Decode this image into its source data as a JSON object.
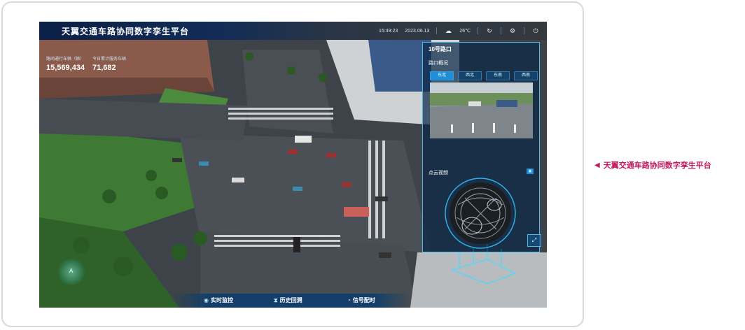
{
  "app": {
    "title": "天翼交通车路协同数字孪生平台"
  },
  "topbar": {
    "time": "15:49:23",
    "date": "2023.06.13",
    "temperature": "26℃"
  },
  "stats": [
    {
      "label": "路网通行车辆（辆）",
      "value": "15,569,434"
    },
    {
      "label": "今日累计服务车辆",
      "value": "71,682"
    }
  ],
  "panel": {
    "title": "10号路口",
    "overview_title": "路口概况",
    "tabs": [
      "东北",
      "西北",
      "东南",
      "西南"
    ],
    "active_tab": 0,
    "lidar_title": "点云视频"
  },
  "bottom_nav": [
    {
      "label": "实时监控",
      "icon": "monitor-icon"
    },
    {
      "label": "历史回溯",
      "icon": "hourglass-icon"
    },
    {
      "label": "信号配时",
      "icon": "signal-icon"
    }
  ],
  "compass": {
    "label": "A"
  },
  "caption": {
    "text": "天翼交通车路协同数字孪生平台"
  },
  "colors": {
    "accent": "#1d8fd8",
    "caption": "#c2185b",
    "panel_border": "#4fb8e8"
  }
}
